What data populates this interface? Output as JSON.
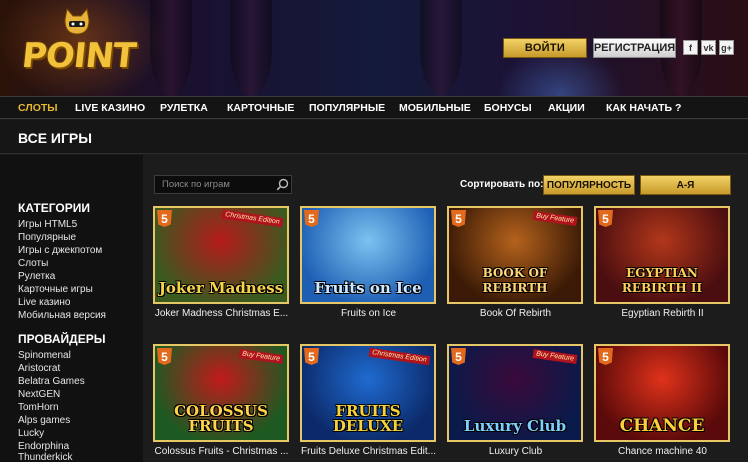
{
  "header": {
    "logo_text": "POINT",
    "login_label": "ВОЙТИ",
    "register_label": "РЕГИСТРАЦИЯ",
    "social": [
      {
        "icon": "facebook-icon",
        "glyph": "f"
      },
      {
        "icon": "vk-icon",
        "glyph": "vk"
      },
      {
        "icon": "google-plus-icon",
        "glyph": "g+"
      }
    ]
  },
  "nav": {
    "items": [
      {
        "label": "СЛОТЫ",
        "active": true
      },
      {
        "label": "LIVE КАЗИНО"
      },
      {
        "label": "РУЛЕТКА"
      },
      {
        "label": "КАРТОЧНЫЕ"
      },
      {
        "label": "ПОПУЛЯРНЫЕ"
      },
      {
        "label": "МОБИЛЬНЫЕ"
      },
      {
        "label": "БОНУСЫ"
      },
      {
        "label": "АКЦИИ"
      },
      {
        "label": "КАК НАЧАТЬ ?"
      }
    ]
  },
  "page_title": "ВСЕ ИГРЫ",
  "sidebar": {
    "categories_heading": "КАТЕГОРИИ",
    "categories": [
      "Игры HTML5",
      "Популярные",
      "Игры с джекпотом",
      "Слоты",
      "Рулетка",
      "Карточные игры",
      "Live казино",
      "Мобильная версия"
    ],
    "providers_heading": "ПРОВАЙДЕРЫ",
    "providers": [
      "Spinomenal",
      "Aristocrat",
      "Belatra Games",
      "NextGEN",
      "TomHorn",
      "Alps games",
      "Lucky",
      "Endorphina",
      "Thunderkick"
    ]
  },
  "toolbar": {
    "search_placeholder": "Поиск по играм",
    "sort_label": "Сортировать по:",
    "sort_popularity": "ПОПУЛЯРНОСТЬ",
    "sort_az": "А-Я"
  },
  "games": [
    {
      "caption": "Joker Madness Christmas E...",
      "art_title": "Joker Madness",
      "badge": "5",
      "tag": "Christmas Edition",
      "colors": [
        "#3a5a20",
        "#b51a1a"
      ],
      "title_color": "#f6d34a"
    },
    {
      "caption": "Fruits on Ice",
      "art_title": "Fruits on Ice",
      "badge": "5",
      "tag": "",
      "colors": [
        "#1e5fb4",
        "#7cc3f0"
      ],
      "title_color": "#cfe9ff"
    },
    {
      "caption": "Book Of Rebirth",
      "art_title": "BOOK OF REBIRTH",
      "badge": "5",
      "tag": "Buy Feature",
      "colors": [
        "#3a1a06",
        "#b5621c"
      ],
      "title_color": "#ffd77a"
    },
    {
      "caption": "Egyptian Rebirth II",
      "art_title": "EGYPTIAN REBIRTH II",
      "badge": "5",
      "tag": "",
      "colors": [
        "#4a0e10",
        "#b2371a"
      ],
      "title_color": "#ffcf5a"
    },
    {
      "caption": "Colossus Fruits - Christmas ...",
      "art_title": "COLOSSUS FRUITS",
      "badge": "5",
      "tag": "Buy Feature",
      "colors": [
        "#1c5a22",
        "#c21a1a"
      ],
      "title_color": "#ffd34a"
    },
    {
      "caption": "Fruits Deluxe Christmas Edit...",
      "art_title": "FRUITS DELUXE",
      "badge": "5",
      "tag": "Christmas Edition",
      "colors": [
        "#0c2a6a",
        "#1f6bd1"
      ],
      "title_color": "#f7d23a"
    },
    {
      "caption": "Luxury Club",
      "art_title": "Luxury Club",
      "badge": "5",
      "tag": "Buy Feature",
      "colors": [
        "#0a1a4a",
        "#3a0a3a"
      ],
      "title_color": "#7fd0ff"
    },
    {
      "caption": "Chance machine 40",
      "art_title": "CHANCE",
      "badge": "5",
      "tag": "",
      "colors": [
        "#5a0a0a",
        "#e0321a"
      ],
      "title_color": "#ffcf3a"
    }
  ]
}
